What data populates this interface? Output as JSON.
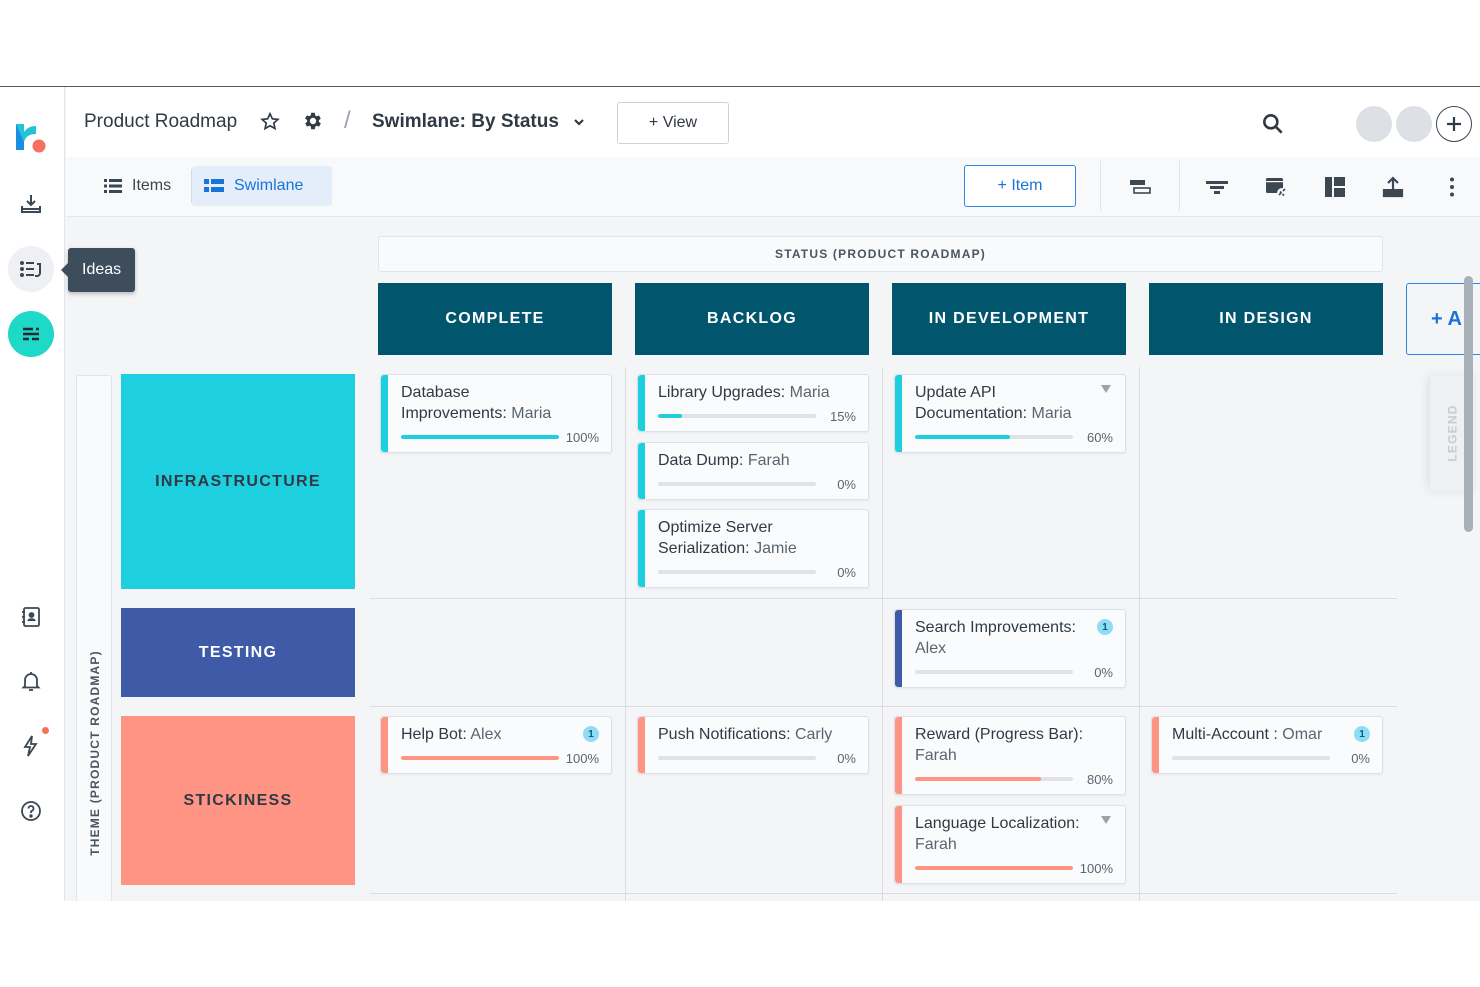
{
  "header": {
    "title": "Product Roadmap",
    "separator": "/",
    "view_name": "Swimlane: By Status",
    "add_view_label": "+ View"
  },
  "rail": {
    "tooltip": "Ideas",
    "items": [
      "logo",
      "import",
      "ideas",
      "roadmap",
      "contacts",
      "notifications",
      "updates",
      "help"
    ]
  },
  "toolbar": {
    "tabs": [
      {
        "label": "Items",
        "active": false
      },
      {
        "label": "Swimlane",
        "active": true
      }
    ],
    "add_item_label": "+ Item"
  },
  "board": {
    "column_axis_label": "STATUS (PRODUCT ROADMAP)",
    "row_axis_label": "THEME (PRODUCT ROADMAP)",
    "columns": [
      "COMPLETE",
      "BACKLOG",
      "IN DEVELOPMENT",
      "IN DESIGN"
    ],
    "add_column_label": "+ A",
    "lanes": [
      {
        "label": "INFRASTRUCTURE",
        "color": "#1ecfe0",
        "text_color": "#2f3a45"
      },
      {
        "label": "TESTING",
        "color": "#3f5ba8",
        "text_color": "#ffffff"
      },
      {
        "label": "STICKINESS",
        "color": "#ff9485",
        "text_color": "#2f3a45"
      }
    ],
    "legend_label": "LEGEND",
    "header_color": "#01566e",
    "cards": [
      {
        "title": "Database Improvements:",
        "owner": "Maria",
        "progress": 100,
        "pct": "100%",
        "lane": 0,
        "col": 0
      },
      {
        "title": "Library Upgrades:",
        "owner": "Maria",
        "progress": 15,
        "pct": "15%",
        "lane": 0,
        "col": 1
      },
      {
        "title": "Data Dump:",
        "owner": "Farah",
        "progress": 0,
        "pct": "0%",
        "lane": 0,
        "col": 1
      },
      {
        "title": "Optimize Server Serialization:",
        "owner": "Jamie",
        "progress": 0,
        "pct": "0%",
        "lane": 0,
        "col": 1
      },
      {
        "title": "Update API Documentation:",
        "owner": "Maria",
        "progress": 60,
        "pct": "60%",
        "lane": 0,
        "col": 2,
        "caret": true
      },
      {
        "title": "Search Improvements:",
        "owner": "Alex",
        "progress": 0,
        "pct": "0%",
        "lane": 1,
        "col": 2,
        "badge": "1"
      },
      {
        "title": "Help Bot:",
        "owner": "Alex",
        "progress": 100,
        "pct": "100%",
        "lane": 2,
        "col": 0,
        "badge": "1"
      },
      {
        "title": "Push Notifications:",
        "owner": "Carly",
        "progress": 0,
        "pct": "0%",
        "lane": 2,
        "col": 1
      },
      {
        "title": "Reward (Progress Bar):",
        "owner": "Farah",
        "progress": 80,
        "pct": "80%",
        "lane": 2,
        "col": 2
      },
      {
        "title": "Language Localization:",
        "owner": "Farah",
        "progress": 100,
        "pct": "100%",
        "lane": 2,
        "col": 2,
        "caret": true
      },
      {
        "title": "Multi-Account :",
        "owner": "Omar",
        "progress": 0,
        "pct": "0%",
        "lane": 2,
        "col": 3,
        "badge": "1"
      }
    ]
  }
}
